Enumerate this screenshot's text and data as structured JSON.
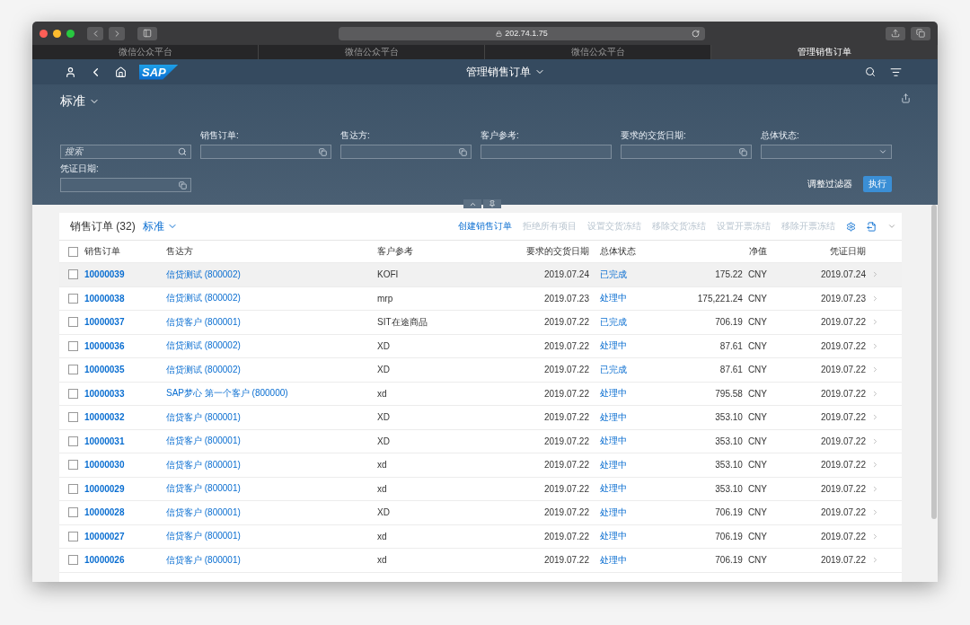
{
  "browser": {
    "address": "202.74.1.75",
    "tabs": [
      {
        "label": "微信公众平台",
        "selected": false
      },
      {
        "label": "微信公众平台",
        "selected": false
      },
      {
        "label": "微信公众平台",
        "selected": false
      },
      {
        "label": "管理销售订单",
        "selected": true
      }
    ]
  },
  "shell": {
    "logo": "SAP",
    "title": "管理销售订单"
  },
  "filter_bar": {
    "variant": "标准",
    "search": {
      "placeholder": "搜索"
    },
    "filters": [
      {
        "label": "销售订单:",
        "kind": "value-help"
      },
      {
        "label": "售达方:",
        "kind": "value-help"
      },
      {
        "label": "客户参考:",
        "kind": "text"
      },
      {
        "label": "要求的交货日期:",
        "kind": "value-help"
      },
      {
        "label": "总体状态:",
        "kind": "select"
      },
      {
        "label": "凭证日期:",
        "kind": "value-help"
      }
    ],
    "adapt_button": "调整过滤器",
    "go_button": "执行"
  },
  "table": {
    "title": "销售订单 (32)",
    "variant": "标准",
    "actions": [
      {
        "label": "创建销售订单",
        "disabled": false
      },
      {
        "label": "拒绝所有项目",
        "disabled": true
      },
      {
        "label": "设置交货冻结",
        "disabled": true
      },
      {
        "label": "移除交货冻结",
        "disabled": true
      },
      {
        "label": "设置开票冻结",
        "disabled": true
      },
      {
        "label": "移除开票冻结",
        "disabled": true
      }
    ],
    "select_all_checked": false,
    "columns": [
      "销售订单",
      "售达方",
      "客户参考",
      "要求的交货日期",
      "总体状态",
      "净值",
      "凭证日期"
    ],
    "rows": [
      {
        "order": "10000039",
        "sold_to": "信贷测试 (800002)",
        "ref": "KOFI",
        "delivery_date": "2019.07.24",
        "status": "已完成",
        "net": "175.22",
        "currency": "CNY",
        "doc_date": "2019.07.24",
        "checked": false,
        "highlighted": true
      },
      {
        "order": "10000038",
        "sold_to": "信贷测试 (800002)",
        "ref": "mrp",
        "delivery_date": "2019.07.23",
        "status": "处理中",
        "net": "175,221.24",
        "currency": "CNY",
        "doc_date": "2019.07.23",
        "checked": false,
        "highlighted": false
      },
      {
        "order": "10000037",
        "sold_to": "信贷客户 (800001)",
        "ref": "SIT在途商品",
        "delivery_date": "2019.07.22",
        "status": "已完成",
        "net": "706.19",
        "currency": "CNY",
        "doc_date": "2019.07.22",
        "checked": false,
        "highlighted": false
      },
      {
        "order": "10000036",
        "sold_to": "信贷测试 (800002)",
        "ref": "XD",
        "delivery_date": "2019.07.22",
        "status": "处理中",
        "net": "87.61",
        "currency": "CNY",
        "doc_date": "2019.07.22",
        "checked": false,
        "highlighted": false
      },
      {
        "order": "10000035",
        "sold_to": "信贷测试 (800002)",
        "ref": "XD",
        "delivery_date": "2019.07.22",
        "status": "已完成",
        "net": "87.61",
        "currency": "CNY",
        "doc_date": "2019.07.22",
        "checked": false,
        "highlighted": false
      },
      {
        "order": "10000033",
        "sold_to": "SAP梦心 第一个客户 (800000)",
        "ref": "xd",
        "delivery_date": "2019.07.22",
        "status": "处理中",
        "net": "795.58",
        "currency": "CNY",
        "doc_date": "2019.07.22",
        "checked": false,
        "highlighted": false
      },
      {
        "order": "10000032",
        "sold_to": "信贷客户 (800001)",
        "ref": "XD",
        "delivery_date": "2019.07.22",
        "status": "处理中",
        "net": "353.10",
        "currency": "CNY",
        "doc_date": "2019.07.22",
        "checked": false,
        "highlighted": false
      },
      {
        "order": "10000031",
        "sold_to": "信贷客户 (800001)",
        "ref": "XD",
        "delivery_date": "2019.07.22",
        "status": "处理中",
        "net": "353.10",
        "currency": "CNY",
        "doc_date": "2019.07.22",
        "checked": false,
        "highlighted": false
      },
      {
        "order": "10000030",
        "sold_to": "信贷客户 (800001)",
        "ref": "xd",
        "delivery_date": "2019.07.22",
        "status": "处理中",
        "net": "353.10",
        "currency": "CNY",
        "doc_date": "2019.07.22",
        "checked": false,
        "highlighted": false
      },
      {
        "order": "10000029",
        "sold_to": "信贷客户 (800001)",
        "ref": "xd",
        "delivery_date": "2019.07.22",
        "status": "处理中",
        "net": "353.10",
        "currency": "CNY",
        "doc_date": "2019.07.22",
        "checked": false,
        "highlighted": false
      },
      {
        "order": "10000028",
        "sold_to": "信贷客户 (800001)",
        "ref": "XD",
        "delivery_date": "2019.07.22",
        "status": "处理中",
        "net": "706.19",
        "currency": "CNY",
        "doc_date": "2019.07.22",
        "checked": false,
        "highlighted": false
      },
      {
        "order": "10000027",
        "sold_to": "信贷客户 (800001)",
        "ref": "xd",
        "delivery_date": "2019.07.22",
        "status": "处理中",
        "net": "706.19",
        "currency": "CNY",
        "doc_date": "2019.07.22",
        "checked": false,
        "highlighted": false
      },
      {
        "order": "10000026",
        "sold_to": "信贷客户 (800001)",
        "ref": "xd",
        "delivery_date": "2019.07.22",
        "status": "处理中",
        "net": "706.19",
        "currency": "CNY",
        "doc_date": "2019.07.22",
        "checked": false,
        "highlighted": false
      }
    ]
  }
}
